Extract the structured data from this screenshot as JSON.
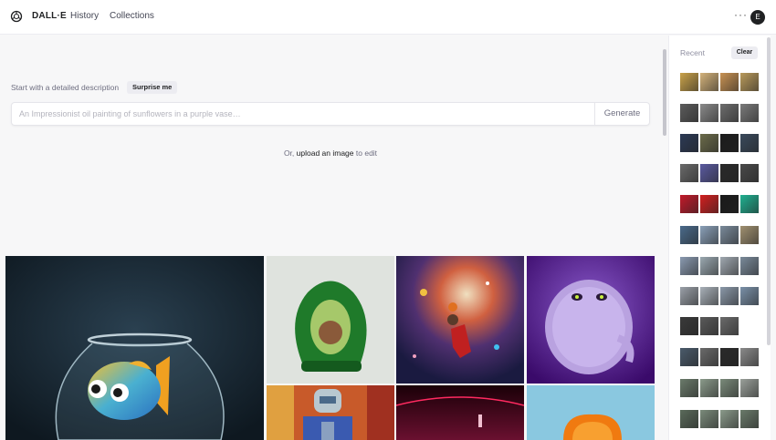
{
  "header": {
    "brand": "DALL·E",
    "nav": {
      "history": "History",
      "collections": "Collections"
    },
    "more_label": "···",
    "avatar_letter": "E"
  },
  "prompt": {
    "intro": "Start with a detailed description",
    "surprise_label": "Surprise me",
    "placeholder": "An Impressionist oil painting of sunflowers in a purple vase…",
    "value": "",
    "generate_label": "Generate",
    "upload_prefix": "Or,",
    "upload_link": "upload an image",
    "upload_suffix": "to edit"
  },
  "recent": {
    "label": "Recent",
    "clear_label": "Clear",
    "rows": [
      [
        "#c9a24a",
        "#d3b27a",
        "#c89253",
        "#b99a5b"
      ],
      [
        "#5c5c5c",
        "#8a8a8a",
        "#6d6d6d",
        "#7a7a7a"
      ],
      [
        "#2c3a55",
        "#6b6b4a",
        "#1c1c1c",
        "#3a4a5c"
      ],
      [
        "#6a6a6a",
        "#5a5aa0",
        "#2a2a2a",
        "#4a4a4a"
      ],
      [
        "#c21a2a",
        "#d22020",
        "#1a1a1a",
        "#20b090"
      ],
      [
        "#4a6a8a",
        "#8aa0b8",
        "#7a8a9a",
        "#a09070"
      ],
      [
        "#8a9ab0",
        "#9aa8b0",
        "#a0a8b0",
        "#7a8a9a"
      ],
      [
        "#9aa0a8",
        "#a8b0b8",
        "#8a98a8",
        "#7a90a8"
      ],
      [
        "#3a3a3a",
        "#5a5a5a",
        "#6a6a6a",
        ""
      ],
      [
        "#4a5a6a",
        "#6a6a6a",
        "#2a2a2a",
        "#8a8a8a"
      ],
      [
        "#6a7a6a",
        "#8a9a8a",
        "#7a8a7a",
        "#9aa09a"
      ],
      [
        "#5a6a5a",
        "#7a8a7a",
        "#8a9a8a",
        "#6a7a6a"
      ]
    ]
  },
  "gallery": [
    {
      "name": "goldfish-bowl-image",
      "icon": "fish-bowl-icon",
      "bg": "#1a2a36"
    },
    {
      "name": "avocado-chair-image",
      "icon": "avocado-chair-icon",
      "bg": "#dfe3de"
    },
    {
      "name": "space-basketball-painting-image",
      "icon": "galaxy-icon",
      "bg": "#2a2240"
    },
    {
      "name": "purple-monster-image",
      "icon": "monster-icon",
      "bg": "#5a2a9a"
    },
    {
      "name": "robot-painting-image",
      "icon": "robot-icon",
      "bg": "#c85a2a"
    },
    {
      "name": "dark-room-image",
      "icon": "room-icon",
      "bg": "#3a0a1a"
    },
    {
      "name": "orange-slice-image",
      "icon": "orange-icon",
      "bg": "#8ac8e0"
    }
  ]
}
